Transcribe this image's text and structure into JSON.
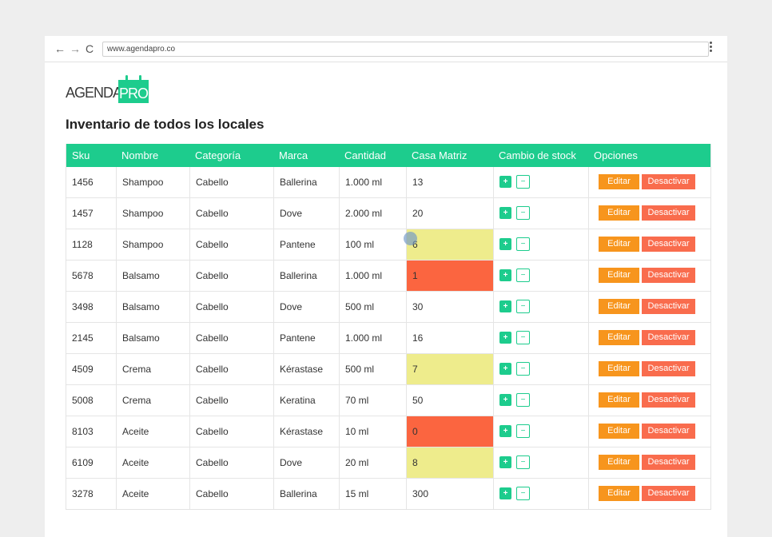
{
  "browser": {
    "back_icon": "←",
    "forward_icon": "→",
    "reload_icon": "C",
    "url": "www.agendapro.co"
  },
  "logo": {
    "left_text": "AGENDA",
    "right_text": "PRO",
    "accent": "#1dcc8d"
  },
  "page": {
    "title": "Inventario de todos los locales"
  },
  "table": {
    "headers": [
      "Sku",
      "Nombre",
      "Categoría",
      "Marca",
      "Cantidad",
      "Casa Matriz",
      "Cambio de stock",
      "Opciones"
    ],
    "plus_label": "+",
    "minus_label": "−",
    "edit_label": "Editar",
    "deactivate_label": "Desactivar",
    "rows": [
      {
        "sku": "1456",
        "nombre": "Shampoo",
        "categoria": "Cabello",
        "marca": "Ballerina",
        "cantidad": "1.000 ml",
        "casa": "13",
        "status": "normal"
      },
      {
        "sku": "1457",
        "nombre": "Shampoo",
        "categoria": "Cabello",
        "marca": "Dove",
        "cantidad": "2.000 ml",
        "casa": "20",
        "status": "normal"
      },
      {
        "sku": "1128",
        "nombre": "Shampoo",
        "categoria": "Cabello",
        "marca": "Pantene",
        "cantidad": "100 ml",
        "casa": "6",
        "status": "low"
      },
      {
        "sku": "5678",
        "nombre": "Balsamo",
        "categoria": "Cabello",
        "marca": "Ballerina",
        "cantidad": "1.000 ml",
        "casa": "1",
        "status": "critical"
      },
      {
        "sku": "3498",
        "nombre": "Balsamo",
        "categoria": "Cabello",
        "marca": "Dove",
        "cantidad": "500 ml",
        "casa": "30",
        "status": "normal"
      },
      {
        "sku": "2145",
        "nombre": "Balsamo",
        "categoria": "Cabello",
        "marca": "Pantene",
        "cantidad": "1.000 ml",
        "casa": "16",
        "status": "normal"
      },
      {
        "sku": "4509",
        "nombre": "Crema",
        "categoria": "Cabello",
        "marca": "Kérastase",
        "cantidad": "500 ml",
        "casa": "7",
        "status": "low"
      },
      {
        "sku": "5008",
        "nombre": "Crema",
        "categoria": "Cabello",
        "marca": "Keratina",
        "cantidad": "70 ml",
        "casa": "50",
        "status": "normal"
      },
      {
        "sku": "8103",
        "nombre": "Aceite",
        "categoria": "Cabello",
        "marca": "Kérastase",
        "cantidad": "10 ml",
        "casa": "0",
        "status": "critical"
      },
      {
        "sku": "6109",
        "nombre": "Aceite",
        "categoria": "Cabello",
        "marca": "Dove",
        "cantidad": "20 ml",
        "casa": "8",
        "status": "low"
      },
      {
        "sku": "3278",
        "nombre": "Aceite",
        "categoria": "Cabello",
        "marca": "Ballerina",
        "cantidad": "15 ml",
        "casa": "300",
        "status": "normal"
      }
    ]
  },
  "colors": {
    "header": "#1dcc8d",
    "low": "#eeec8c",
    "critical": "#fb6540",
    "edit": "#f7951d",
    "deactivate": "#f96c4d"
  }
}
